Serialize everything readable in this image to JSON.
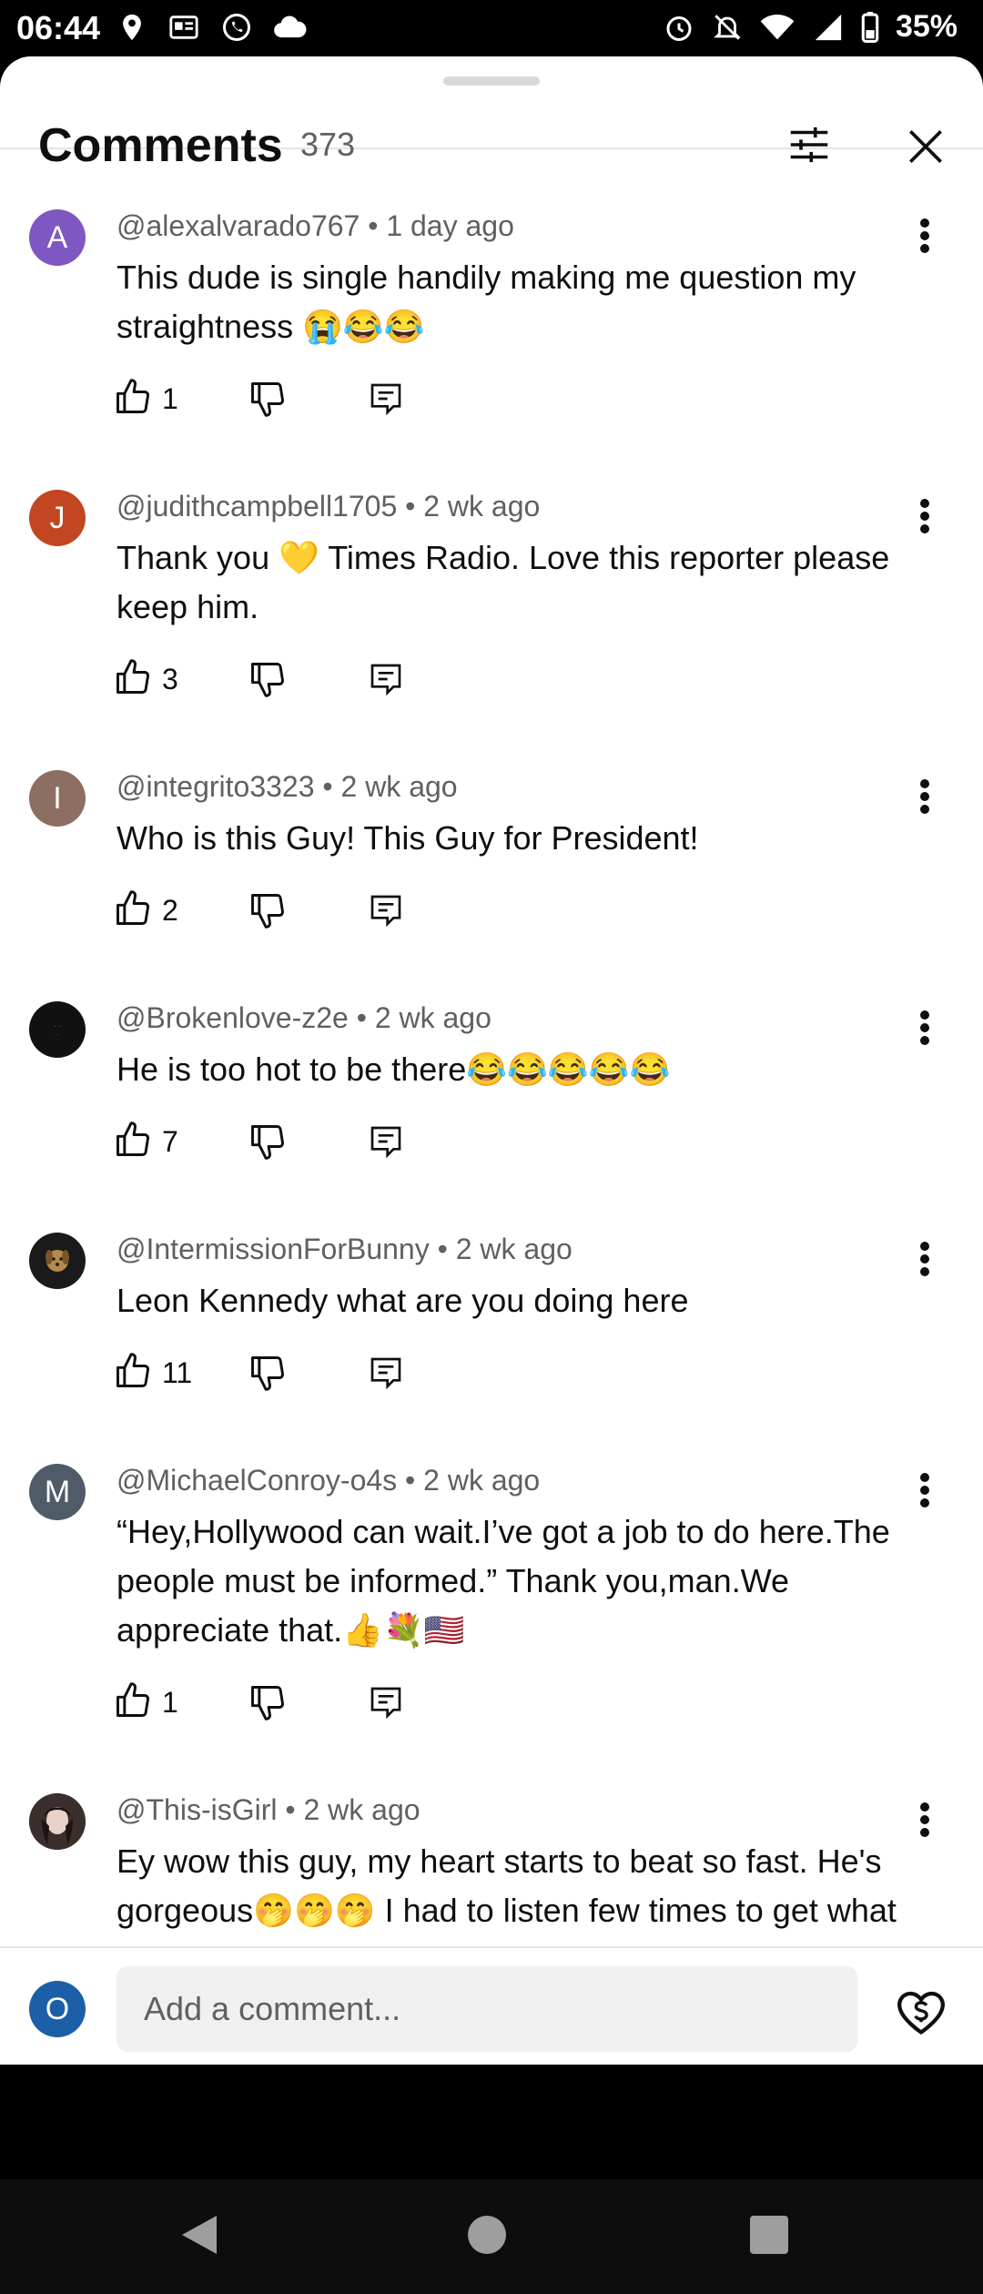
{
  "status_bar": {
    "time": "06:44",
    "battery": "35%"
  },
  "header": {
    "title": "Comments",
    "count": "373"
  },
  "comments": [
    {
      "initial": "A",
      "avatar_color": "#7e57c2",
      "author": "@alexalvarado767",
      "age": "1 day ago",
      "text": "This dude is single handily making me question my straightness 😭😂😂",
      "likes": "1"
    },
    {
      "initial": "J",
      "avatar_color": "#c2461f",
      "author": "@judithcampbell1705",
      "age": "2 wk ago",
      "text": "Thank you 💛 Times Radio. Love this reporter please keep him.",
      "likes": "3"
    },
    {
      "initial": "I",
      "avatar_color": "#8d6e63",
      "author": "@integrito3323",
      "age": "2 wk ago",
      "text": "Who is this Guy! This Guy for President!",
      "likes": "2"
    },
    {
      "initial": "",
      "avatar_color": "#111111",
      "author": "@Brokenlove-z2e",
      "age": "2 wk ago",
      "text": "He is too hot to be there😂😂😂😂😂",
      "likes": "7"
    },
    {
      "initial": "",
      "avatar_color": "#1a1a1a",
      "author": "@IntermissionForBunny",
      "age": "2 wk ago",
      "text": "Leon Kennedy what are you doing here",
      "likes": "11"
    },
    {
      "initial": "M",
      "avatar_color": "#4f5b66",
      "author": "@MichaelConroy-o4s",
      "age": "2 wk ago",
      "text": "“Hey,Hollywood can wait.I’ve got a job to do here.The people must be informed.” Thank you,man.We appreciate that.👍💐🇺🇸",
      "likes": "1"
    },
    {
      "initial": "",
      "avatar_color": "#5a4f4a",
      "author": "@This-isGirl",
      "age": "2 wk ago",
      "text": "Ey wow this guy, my heart starts to beat so fast. He's gorgeous🤭🤭🤭  I had to listen few times to get what he says",
      "likes": ""
    }
  ],
  "composer": {
    "user_initial": "O",
    "placeholder": "Add a comment..."
  }
}
